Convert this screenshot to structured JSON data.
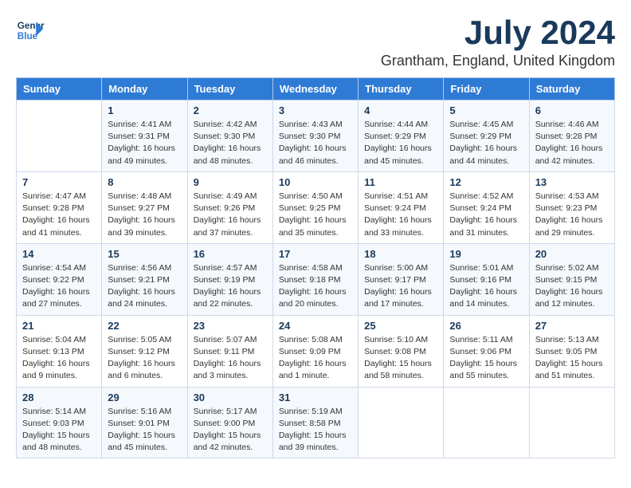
{
  "logo": {
    "line1": "General",
    "line2": "Blue"
  },
  "title": "July 2024",
  "location": "Grantham, England, United Kingdom",
  "days_header": [
    "Sunday",
    "Monday",
    "Tuesday",
    "Wednesday",
    "Thursday",
    "Friday",
    "Saturday"
  ],
  "weeks": [
    [
      {
        "num": "",
        "info": ""
      },
      {
        "num": "1",
        "info": "Sunrise: 4:41 AM\nSunset: 9:31 PM\nDaylight: 16 hours\nand 49 minutes."
      },
      {
        "num": "2",
        "info": "Sunrise: 4:42 AM\nSunset: 9:30 PM\nDaylight: 16 hours\nand 48 minutes."
      },
      {
        "num": "3",
        "info": "Sunrise: 4:43 AM\nSunset: 9:30 PM\nDaylight: 16 hours\nand 46 minutes."
      },
      {
        "num": "4",
        "info": "Sunrise: 4:44 AM\nSunset: 9:29 PM\nDaylight: 16 hours\nand 45 minutes."
      },
      {
        "num": "5",
        "info": "Sunrise: 4:45 AM\nSunset: 9:29 PM\nDaylight: 16 hours\nand 44 minutes."
      },
      {
        "num": "6",
        "info": "Sunrise: 4:46 AM\nSunset: 9:28 PM\nDaylight: 16 hours\nand 42 minutes."
      }
    ],
    [
      {
        "num": "7",
        "info": "Sunrise: 4:47 AM\nSunset: 9:28 PM\nDaylight: 16 hours\nand 41 minutes."
      },
      {
        "num": "8",
        "info": "Sunrise: 4:48 AM\nSunset: 9:27 PM\nDaylight: 16 hours\nand 39 minutes."
      },
      {
        "num": "9",
        "info": "Sunrise: 4:49 AM\nSunset: 9:26 PM\nDaylight: 16 hours\nand 37 minutes."
      },
      {
        "num": "10",
        "info": "Sunrise: 4:50 AM\nSunset: 9:25 PM\nDaylight: 16 hours\nand 35 minutes."
      },
      {
        "num": "11",
        "info": "Sunrise: 4:51 AM\nSunset: 9:24 PM\nDaylight: 16 hours\nand 33 minutes."
      },
      {
        "num": "12",
        "info": "Sunrise: 4:52 AM\nSunset: 9:24 PM\nDaylight: 16 hours\nand 31 minutes."
      },
      {
        "num": "13",
        "info": "Sunrise: 4:53 AM\nSunset: 9:23 PM\nDaylight: 16 hours\nand 29 minutes."
      }
    ],
    [
      {
        "num": "14",
        "info": "Sunrise: 4:54 AM\nSunset: 9:22 PM\nDaylight: 16 hours\nand 27 minutes."
      },
      {
        "num": "15",
        "info": "Sunrise: 4:56 AM\nSunset: 9:21 PM\nDaylight: 16 hours\nand 24 minutes."
      },
      {
        "num": "16",
        "info": "Sunrise: 4:57 AM\nSunset: 9:19 PM\nDaylight: 16 hours\nand 22 minutes."
      },
      {
        "num": "17",
        "info": "Sunrise: 4:58 AM\nSunset: 9:18 PM\nDaylight: 16 hours\nand 20 minutes."
      },
      {
        "num": "18",
        "info": "Sunrise: 5:00 AM\nSunset: 9:17 PM\nDaylight: 16 hours\nand 17 minutes."
      },
      {
        "num": "19",
        "info": "Sunrise: 5:01 AM\nSunset: 9:16 PM\nDaylight: 16 hours\nand 14 minutes."
      },
      {
        "num": "20",
        "info": "Sunrise: 5:02 AM\nSunset: 9:15 PM\nDaylight: 16 hours\nand 12 minutes."
      }
    ],
    [
      {
        "num": "21",
        "info": "Sunrise: 5:04 AM\nSunset: 9:13 PM\nDaylight: 16 hours\nand 9 minutes."
      },
      {
        "num": "22",
        "info": "Sunrise: 5:05 AM\nSunset: 9:12 PM\nDaylight: 16 hours\nand 6 minutes."
      },
      {
        "num": "23",
        "info": "Sunrise: 5:07 AM\nSunset: 9:11 PM\nDaylight: 16 hours\nand 3 minutes."
      },
      {
        "num": "24",
        "info": "Sunrise: 5:08 AM\nSunset: 9:09 PM\nDaylight: 16 hours\nand 1 minute."
      },
      {
        "num": "25",
        "info": "Sunrise: 5:10 AM\nSunset: 9:08 PM\nDaylight: 15 hours\nand 58 minutes."
      },
      {
        "num": "26",
        "info": "Sunrise: 5:11 AM\nSunset: 9:06 PM\nDaylight: 15 hours\nand 55 minutes."
      },
      {
        "num": "27",
        "info": "Sunrise: 5:13 AM\nSunset: 9:05 PM\nDaylight: 15 hours\nand 51 minutes."
      }
    ],
    [
      {
        "num": "28",
        "info": "Sunrise: 5:14 AM\nSunset: 9:03 PM\nDaylight: 15 hours\nand 48 minutes."
      },
      {
        "num": "29",
        "info": "Sunrise: 5:16 AM\nSunset: 9:01 PM\nDaylight: 15 hours\nand 45 minutes."
      },
      {
        "num": "30",
        "info": "Sunrise: 5:17 AM\nSunset: 9:00 PM\nDaylight: 15 hours\nand 42 minutes."
      },
      {
        "num": "31",
        "info": "Sunrise: 5:19 AM\nSunset: 8:58 PM\nDaylight: 15 hours\nand 39 minutes."
      },
      {
        "num": "",
        "info": ""
      },
      {
        "num": "",
        "info": ""
      },
      {
        "num": "",
        "info": ""
      }
    ]
  ]
}
